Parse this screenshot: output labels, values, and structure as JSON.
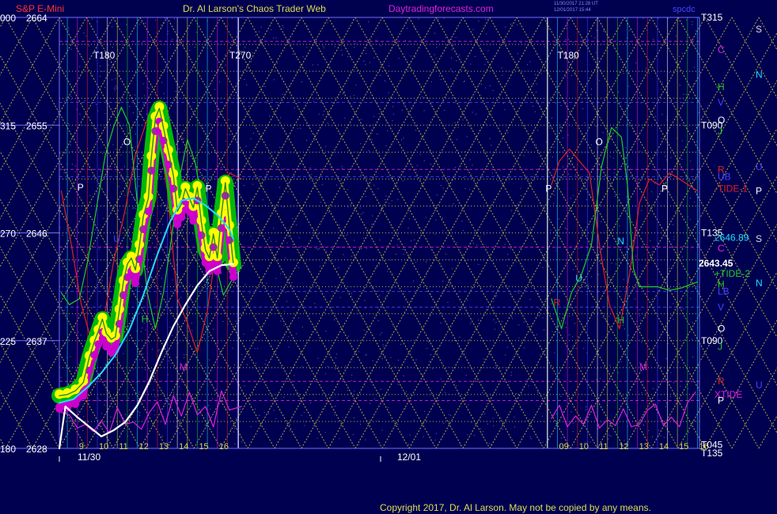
{
  "header": {
    "instrument": "S&P E-Mini",
    "site_title": "Dr. Al Larson's Chaos Trader Web",
    "site_url": "Daytradingforecasts.com",
    "timestamp_1": "11/30/2017 21:28 UT",
    "timestamp_2": "12/01/2017 15:44",
    "corner_tag": "spcdc"
  },
  "footer": {
    "copyright": "Copyright 2017, Dr. Al Larson. May not be copied by any means."
  },
  "colors": {
    "background": "#000050",
    "plot_border": "#7070ff",
    "price_yellow": "#ffff00",
    "price_green_halo": "#00cc00",
    "price_magenta": "#cc00cc",
    "cyan_average": "#22ddff",
    "white_average": "#ffffff",
    "green_tide": "#22cc22",
    "red_tide": "#dd2222",
    "xtide_magenta": "#dd22dd"
  },
  "chart_data": {
    "type": "line",
    "title": "S&P E-Mini",
    "x_dates": [
      "11/30",
      "12/01"
    ],
    "x_hour_ticks": [
      "9",
      "10",
      "11",
      "12",
      "13",
      "14",
      "15",
      "16",
      "09",
      "10",
      "11",
      "12",
      "13",
      "14",
      "15",
      "16"
    ],
    "x_hour_values": [
      9,
      10,
      11,
      12,
      13,
      14,
      15,
      16,
      33,
      34,
      35,
      36,
      37,
      38,
      39,
      40
    ],
    "xlim": [
      8.1,
      40.1
    ],
    "ylim": [
      2628,
      2664
    ],
    "y_price_ticks": [
      2628,
      2637,
      2646,
      2655,
      2664
    ],
    "y_angle_ticks": [
      "180",
      "225",
      "270",
      "315",
      "000"
    ],
    "time_markers": [
      {
        "label": "T180",
        "x": 9.8
      },
      {
        "label": "T270",
        "x": 16.6
      },
      {
        "label": "T180",
        "x": 33.0
      }
    ],
    "last_price_label": "2643.45",
    "last_price": 2643.45,
    "right_axis_labels": [
      {
        "text": "T315",
        "y": 2664,
        "color": "#ffffff"
      },
      {
        "text": "T090",
        "y": 2655,
        "color": "#ffffff"
      },
      {
        "text": "T135",
        "y": 2646,
        "color": "#ffffff"
      },
      {
        "text": "T090",
        "y": 2637,
        "color": "#ffffff"
      },
      {
        "text": "T045",
        "y": 2628.3,
        "color": "#ffffff"
      },
      {
        "text": "T135",
        "y": 2627.6,
        "color": "#ffffff"
      },
      {
        "text": "2646.89",
        "y": 2645.6,
        "color": "#22ddff"
      },
      {
        "text": "C",
        "y": 2661.3,
        "color": "#dd22dd"
      },
      {
        "text": "H",
        "y": 2658.2,
        "color": "#22cc22"
      },
      {
        "text": "V",
        "y": 2656.9,
        "color": "#4444ff"
      },
      {
        "text": "O",
        "y": 2655.4,
        "color": "#ffffff"
      },
      {
        "text": "J",
        "y": 2654.5,
        "color": "#22cc22"
      },
      {
        "text": "R",
        "y": 2651.3,
        "color": "#dd2222"
      },
      {
        "text": "UB",
        "y": 2650.7,
        "color": "#4444ff"
      },
      {
        "text": "-TIDE-1",
        "y": 2649.7,
        "color": "#dd2222"
      },
      {
        "text": "C",
        "y": 2644.7,
        "color": "#dd22dd"
      },
      {
        "text": "+TIDE-2",
        "y": 2642.6,
        "color": "#22cc22"
      },
      {
        "text": "H",
        "y": 2641.7,
        "color": "#22cc22"
      },
      {
        "text": "LB",
        "y": 2641.1,
        "color": "#4444ff"
      },
      {
        "text": "V",
        "y": 2639.8,
        "color": "#4444ff"
      },
      {
        "text": "O",
        "y": 2638.0,
        "color": "#ffffff"
      },
      {
        "text": "J",
        "y": 2636.5,
        "color": "#22cc22"
      },
      {
        "text": "R",
        "y": 2633.6,
        "color": "#dd2222"
      },
      {
        "text": "XTIDE",
        "y": 2632.5,
        "color": "#dd22dd"
      },
      {
        "text": "P",
        "y": 2632.0,
        "color": "#ffffff"
      }
    ],
    "far_right_labels": [
      {
        "text": "S",
        "y": 2663.0,
        "color": "#dddddd"
      },
      {
        "text": "N",
        "y": 2659.2,
        "color": "#22ddff"
      },
      {
        "text": "P",
        "y": 2649.5,
        "color": "#ffffff"
      },
      {
        "text": "S",
        "y": 2645.5,
        "color": "#dddddd"
      },
      {
        "text": "N",
        "y": 2641.8,
        "color": "#22ddff"
      },
      {
        "text": "U",
        "y": 2651.5,
        "color": "#4444ff"
      },
      {
        "text": "U",
        "y": 2633.3,
        "color": "#4444ff"
      }
    ],
    "in_plot_letters": [
      {
        "text": "P",
        "x": 9.0,
        "y": 2649.8,
        "color": "#ffffff"
      },
      {
        "text": "O",
        "x": 11.3,
        "y": 2653.6,
        "color": "#ffffff"
      },
      {
        "text": "U",
        "x": 10.8,
        "y": 2645.5,
        "color": "#4444ff"
      },
      {
        "text": "H",
        "x": 12.2,
        "y": 2638.8,
        "color": "#22cc22"
      },
      {
        "text": "P",
        "x": 15.4,
        "y": 2649.7,
        "color": "#ffffff"
      },
      {
        "text": "M",
        "x": 14.1,
        "y": 2634.8,
        "color": "#dd22dd"
      },
      {
        "text": "P",
        "x": 32.4,
        "y": 2649.7,
        "color": "#ffffff"
      },
      {
        "text": "R",
        "x": 32.8,
        "y": 2640.2,
        "color": "#dd2222"
      },
      {
        "text": "U",
        "x": 33.9,
        "y": 2642.2,
        "color": "#22ddff"
      },
      {
        "text": "O",
        "x": 34.9,
        "y": 2653.6,
        "color": "#ffffff"
      },
      {
        "text": "N",
        "x": 36.0,
        "y": 2645.3,
        "color": "#22ddff"
      },
      {
        "text": "H",
        "x": 36.0,
        "y": 2638.7,
        "color": "#22cc22"
      },
      {
        "text": "M",
        "x": 37.1,
        "y": 2634.8,
        "color": "#dd22dd"
      },
      {
        "text": "P",
        "x": 38.2,
        "y": 2649.7,
        "color": "#ffffff"
      }
    ],
    "series": [
      {
        "name": "price",
        "color": "#ffff00",
        "x": [
          8.1,
          8.5,
          8.9,
          9.3,
          9.6,
          9.85,
          10.05,
          10.25,
          10.45,
          10.7,
          10.9,
          11.1,
          11.3,
          11.5,
          11.7,
          11.9,
          12.1,
          12.3,
          12.55,
          12.7,
          12.9,
          13.1,
          13.3,
          13.55,
          13.8,
          14.0,
          14.2,
          14.4,
          14.6,
          14.8,
          15.0,
          15.2,
          15.4,
          15.6,
          15.8,
          16.0,
          16.2,
          16.4,
          16.6,
          16.8
        ],
        "y": [
          2632.4,
          2632.5,
          2632.8,
          2633.5,
          2635.6,
          2636.9,
          2637.8,
          2638.8,
          2637.6,
          2637.1,
          2637.3,
          2639.5,
          2641.9,
          2643.4,
          2643.9,
          2642.9,
          2644.9,
          2647.4,
          2648.9,
          2652.3,
          2655.6,
          2656.4,
          2654.8,
          2652.8,
          2650.8,
          2647.8,
          2648.4,
          2649.7,
          2648.9,
          2648.1,
          2649.8,
          2646.9,
          2644.6,
          2643.9,
          2645.9,
          2643.9,
          2647.5,
          2650.2,
          2646.5,
          2643.4
        ]
      },
      {
        "name": "cyan_average",
        "color": "#22ddff",
        "x": [
          8.1,
          8.8,
          9.5,
          10.2,
          10.9,
          11.6,
          12.3,
          13.0,
          13.6,
          14.2,
          14.8,
          15.4,
          16.0,
          16.6,
          16.8
        ],
        "y": [
          2631.8,
          2632.1,
          2633.1,
          2634.3,
          2635.8,
          2637.9,
          2640.8,
          2644.2,
          2646.8,
          2648.7,
          2648.9,
          2648.3,
          2647.5,
          2646.3,
          2645.5
        ]
      },
      {
        "name": "white_average",
        "color": "#ffffff",
        "x": [
          8.1,
          8.4,
          9.0,
          9.6,
          10.2,
          10.8,
          11.4,
          12.0,
          12.6,
          13.2,
          13.8,
          14.4,
          15.0,
          15.6,
          16.2,
          16.8
        ],
        "y": [
          2628.0,
          2631.5,
          2630.6,
          2629.8,
          2629.0,
          2629.5,
          2630.2,
          2631.6,
          2633.6,
          2636.0,
          2638.2,
          2640.0,
          2641.6,
          2642.8,
          2643.3,
          2643.4
        ]
      },
      {
        "name": "green_tide",
        "color": "#22cc22",
        "x": [
          8.2,
          8.6,
          9.1,
          9.5,
          10.0,
          10.4,
          10.8,
          11.2,
          11.6,
          12.0,
          12.5,
          12.9,
          13.3,
          13.7,
          14.1,
          14.5,
          14.9,
          15.4,
          15.9,
          16.3,
          16.7,
          17.2,
          32.7,
          33.2,
          33.7,
          34.2,
          34.7,
          35.2,
          35.7,
          36.2,
          36.5,
          36.8,
          37.1,
          37.5,
          38.0,
          38.6,
          39.2,
          40.0
        ],
        "y": [
          2641.0,
          2640.0,
          2640.5,
          2643.5,
          2648.5,
          2652.5,
          2654.8,
          2656.5,
          2655.0,
          2648.5,
          2641.0,
          2638.0,
          2641.0,
          2645.5,
          2650.5,
          2653.8,
          2651.8,
          2647.0,
          2643.5,
          2640.8,
          2642.0,
          2643.2,
          2640.5,
          2638.0,
          2641.0,
          2642.5,
          2645.0,
          2651.5,
          2654.8,
          2654.0,
          2650.0,
          2643.0,
          2641.5,
          2641.5,
          2641.5,
          2641.2,
          2641.4,
          2641.9
        ]
      },
      {
        "name": "red_tide",
        "color": "#dd2222",
        "x": [
          8.2,
          8.7,
          9.2,
          9.7,
          10.3,
          10.8,
          11.4,
          11.9,
          12.5,
          13.1,
          13.5,
          14.0,
          14.5,
          15.0,
          15.5,
          16.1,
          16.6,
          17.2,
          32.7,
          33.1,
          33.6,
          34.1,
          34.6,
          35.1,
          35.6,
          36.1,
          36.6,
          37.1,
          37.6,
          38.1,
          38.6,
          39.1,
          40.0
        ],
        "y": [
          2649.5,
          2645.0,
          2640.0,
          2637.0,
          2638.5,
          2643.5,
          2648.0,
          2652.5,
          2655.5,
          2654.0,
          2649.5,
          2640.5,
          2638.5,
          2636.0,
          2639.5,
          2646.5,
          2651.0,
          2650.5,
          2650.0,
          2652.0,
          2653.0,
          2652.0,
          2651.0,
          2645.0,
          2640.0,
          2638.0,
          2642.5,
          2648.5,
          2650.5,
          2650.0,
          2651.0,
          2650.5,
          2649.5
        ]
      },
      {
        "name": "xtide",
        "color": "#dd22dd",
        "x": [
          8.2,
          8.6,
          9.0,
          9.4,
          9.8,
          10.2,
          10.6,
          11.0,
          11.4,
          11.8,
          12.2,
          12.6,
          13.0,
          13.4,
          13.8,
          14.2,
          14.6,
          15.0,
          15.4,
          15.8,
          16.2,
          16.6,
          17.2,
          32.7,
          33.1,
          33.5,
          33.9,
          34.3,
          34.7,
          35.1,
          35.5,
          35.9,
          36.3,
          36.7,
          37.1,
          37.5,
          37.9,
          38.3,
          38.7,
          39.1,
          39.5,
          39.9
        ],
        "y": [
          2631.0,
          2630.8,
          2629.7,
          2630.0,
          2629.4,
          2630.3,
          2629.3,
          2631.4,
          2630.0,
          2630.2,
          2629.6,
          2631.0,
          2631.9,
          2630.0,
          2632.4,
          2630.7,
          2632.7,
          2630.8,
          2631.5,
          2629.8,
          2632.8,
          2631.2,
          2631.5,
          2630.5,
          2631.6,
          2629.8,
          2630.7,
          2630.0,
          2631.6,
          2629.7,
          2630.4,
          2629.9,
          2631.3,
          2629.8,
          2630.0,
          2631.2,
          2631.7,
          2629.9,
          2630.6,
          2629.8,
          2631.8,
          2632.7
        ]
      }
    ]
  }
}
